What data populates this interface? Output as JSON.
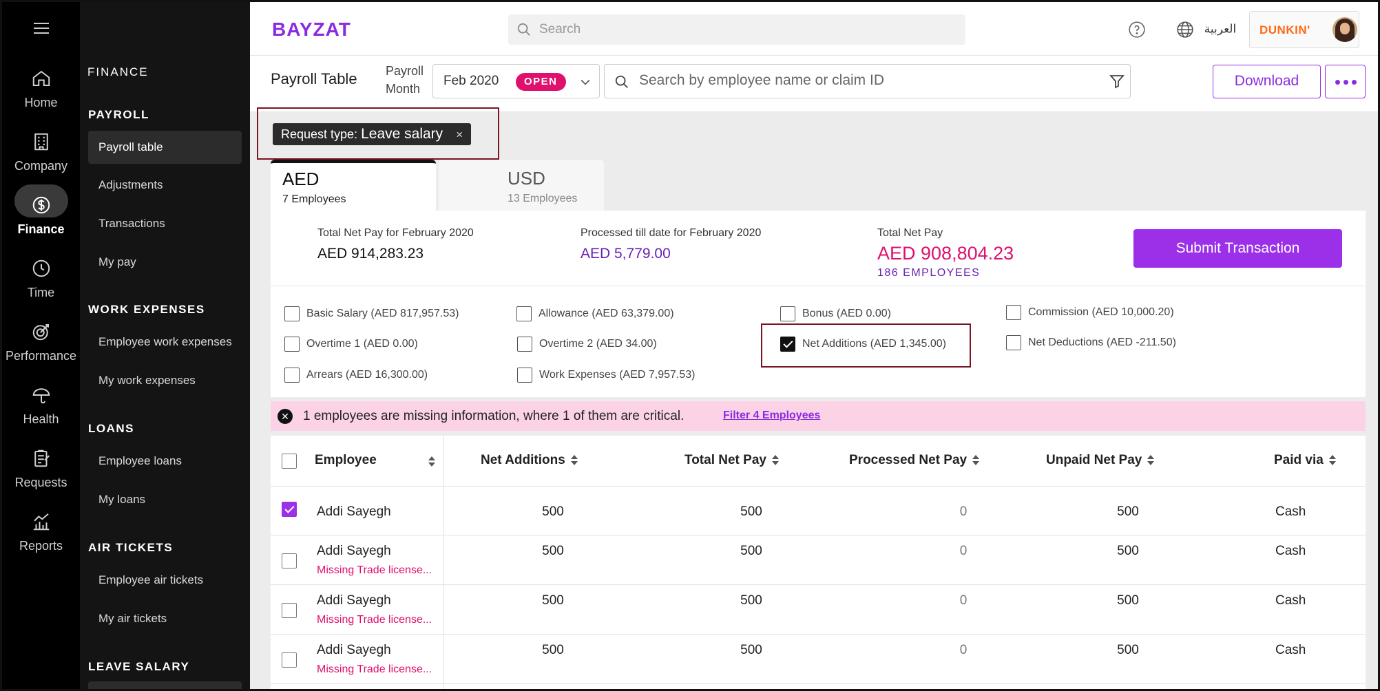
{
  "nav_rail": [
    {
      "label": "Home",
      "icon": "home-icon"
    },
    {
      "label": "Company",
      "icon": "building-icon"
    },
    {
      "label": "Finance",
      "icon": "dollar-icon",
      "active": true
    },
    {
      "label": "Time",
      "icon": "clock-icon"
    },
    {
      "label": "Performance",
      "icon": "target-icon"
    },
    {
      "label": "Health",
      "icon": "umbrella-icon"
    },
    {
      "label": "Requests",
      "icon": "clipboard-icon"
    },
    {
      "label": "Reports",
      "icon": "chart-icon"
    }
  ],
  "sidebar": {
    "title": "FINANCE",
    "sections": [
      {
        "title": "PAYROLL",
        "items": [
          "Payroll table",
          "Adjustments",
          "Transactions",
          "My pay"
        ]
      },
      {
        "title": "WORK EXPENSES",
        "items": [
          "Employee work expenses",
          "My work expenses"
        ]
      },
      {
        "title": "LOANS",
        "items": [
          "Employee loans",
          "My loans"
        ]
      },
      {
        "title": "AIR TICKETS",
        "items": [
          "Employee air tickets",
          "My air tickets"
        ]
      },
      {
        "title": "LEAVE SALARY",
        "items": []
      }
    ],
    "active_item": "Payroll table"
  },
  "header": {
    "logo": "BAYZAT",
    "search_placeholder": "Search",
    "language": "العربية",
    "brand": "DUNKIN'"
  },
  "toolbar": {
    "title": "Payroll Table",
    "month_label_1": "Payroll",
    "month_label_2": "Month",
    "month_value": "Feb 2020",
    "month_badge": "OPEN",
    "search_placeholder": "Search by employee name or claim ID",
    "download_label": "Download"
  },
  "filter_chip": {
    "prefix": "Request type:",
    "value": "Leave salary",
    "close": "×"
  },
  "tabs": [
    {
      "currency": "AED",
      "count": "7 Employees",
      "active": true
    },
    {
      "currency": "USD",
      "count": "13 Employees",
      "active": false
    }
  ],
  "summary": {
    "total_label": "Total Net Pay for February 2020",
    "total_value": "AED 914,283.23",
    "processed_label": "Processed till date for February 2020",
    "processed_value": "AED 5,779.00",
    "net_label": "Total Net Pay",
    "net_value": "AED 908,804.23",
    "employees": "186 EMPLOYEES",
    "submit_label": "Submit Transaction"
  },
  "components": [
    {
      "label": "Basic Salary (AED 817,957.53)",
      "checked": false
    },
    {
      "label": "Allowance (AED 63,379.00)",
      "checked": false
    },
    {
      "label": "Bonus (AED 0.00)",
      "checked": false
    },
    {
      "label": "Commission (AED 10,000.20)",
      "checked": false
    },
    {
      "label": "Overtime 1 (AED 0.00)",
      "checked": false
    },
    {
      "label": "Overtime 2 (AED 34.00)",
      "checked": false
    },
    {
      "label": "Net Additions (AED 1,345.00)",
      "checked": true
    },
    {
      "label": "Net Deductions (AED -211.50)",
      "checked": false
    },
    {
      "label": "Arrears (AED 16,300.00)",
      "checked": false
    },
    {
      "label": "Work Expenses (AED 7,957.53)",
      "checked": false
    }
  ],
  "alert": {
    "text": "1 employees are missing information, where 1 of them are critical.",
    "link": "Filter 4 Employees"
  },
  "table": {
    "columns": [
      "Employee",
      "Net Additions",
      "Total Net Pay",
      "Processed Net Pay",
      "Unpaid Net Pay",
      "Paid via"
    ],
    "rows": [
      {
        "name": "Addi Sayegh",
        "warning": "",
        "net_additions": "500",
        "total_net_pay": "500",
        "processed": "0",
        "unpaid": "500",
        "paid_via": "Cash",
        "checked": true
      },
      {
        "name": "Addi Sayegh",
        "warning": "Missing Trade license...",
        "net_additions": "500",
        "total_net_pay": "500",
        "processed": "0",
        "unpaid": "500",
        "paid_via": "Cash",
        "checked": false
      },
      {
        "name": "Addi Sayegh",
        "warning": "Missing Trade license...",
        "net_additions": "500",
        "total_net_pay": "500",
        "processed": "0",
        "unpaid": "500",
        "paid_via": "Cash",
        "checked": false
      },
      {
        "name": "Addi Sayegh",
        "warning": "Missing Trade license...",
        "net_additions": "500",
        "total_net_pay": "500",
        "processed": "0",
        "unpaid": "500",
        "paid_via": "Cash",
        "checked": false
      }
    ]
  }
}
